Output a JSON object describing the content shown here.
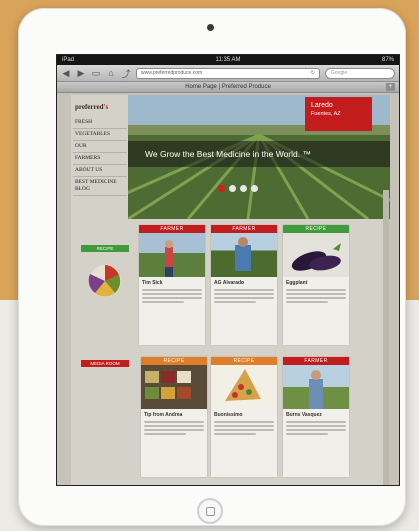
{
  "status_bar": {
    "carrier": "iPad",
    "time": "11:35 AM",
    "battery": "87%"
  },
  "browser": {
    "url": "www.preferredproduce.com",
    "tab_title": "Home Page | Preferred Produce",
    "search_placeholder": "Google",
    "icons": [
      "back-icon",
      "forward-icon",
      "book-icon",
      "bookmarks-icon",
      "share-icon"
    ]
  },
  "site": {
    "logo_first": "preferred",
    "logo_second": "'s",
    "nav": [
      "Fresh",
      "Vegetables",
      "Our",
      "Farmers",
      "About Us",
      "Best Medicine Blog"
    ],
    "hero": {
      "badge_title": "Laredo",
      "badge_subtitle": "Fuentes, AZ",
      "tagline": "We Grow the Best Medicine in the World. ™",
      "slides": 4,
      "active_slide": 1
    },
    "widgets": [
      {
        "heading": "Recipe",
        "color": "#3f9b3a"
      },
      {
        "heading": "Media Room",
        "color": "#c21c1c"
      }
    ],
    "cards": [
      {
        "label": "Farmer",
        "title": "Tim Sick",
        "color": "#c21c1c"
      },
      {
        "label": "Farmer",
        "title": "AG Alvarado",
        "color": "#c21c1c"
      },
      {
        "label": "Recipe",
        "title": "Eggplant",
        "color": "#3f9b3a"
      },
      {
        "label": "Recipe",
        "title": "Tip from Andrea",
        "color": "#de7e2a"
      },
      {
        "label": "Recipe",
        "title": "Buonissimo",
        "color": "#de7e2a"
      },
      {
        "label": "Farmer",
        "title": "Burns Vasquez",
        "color": "#c21c1c"
      }
    ]
  }
}
